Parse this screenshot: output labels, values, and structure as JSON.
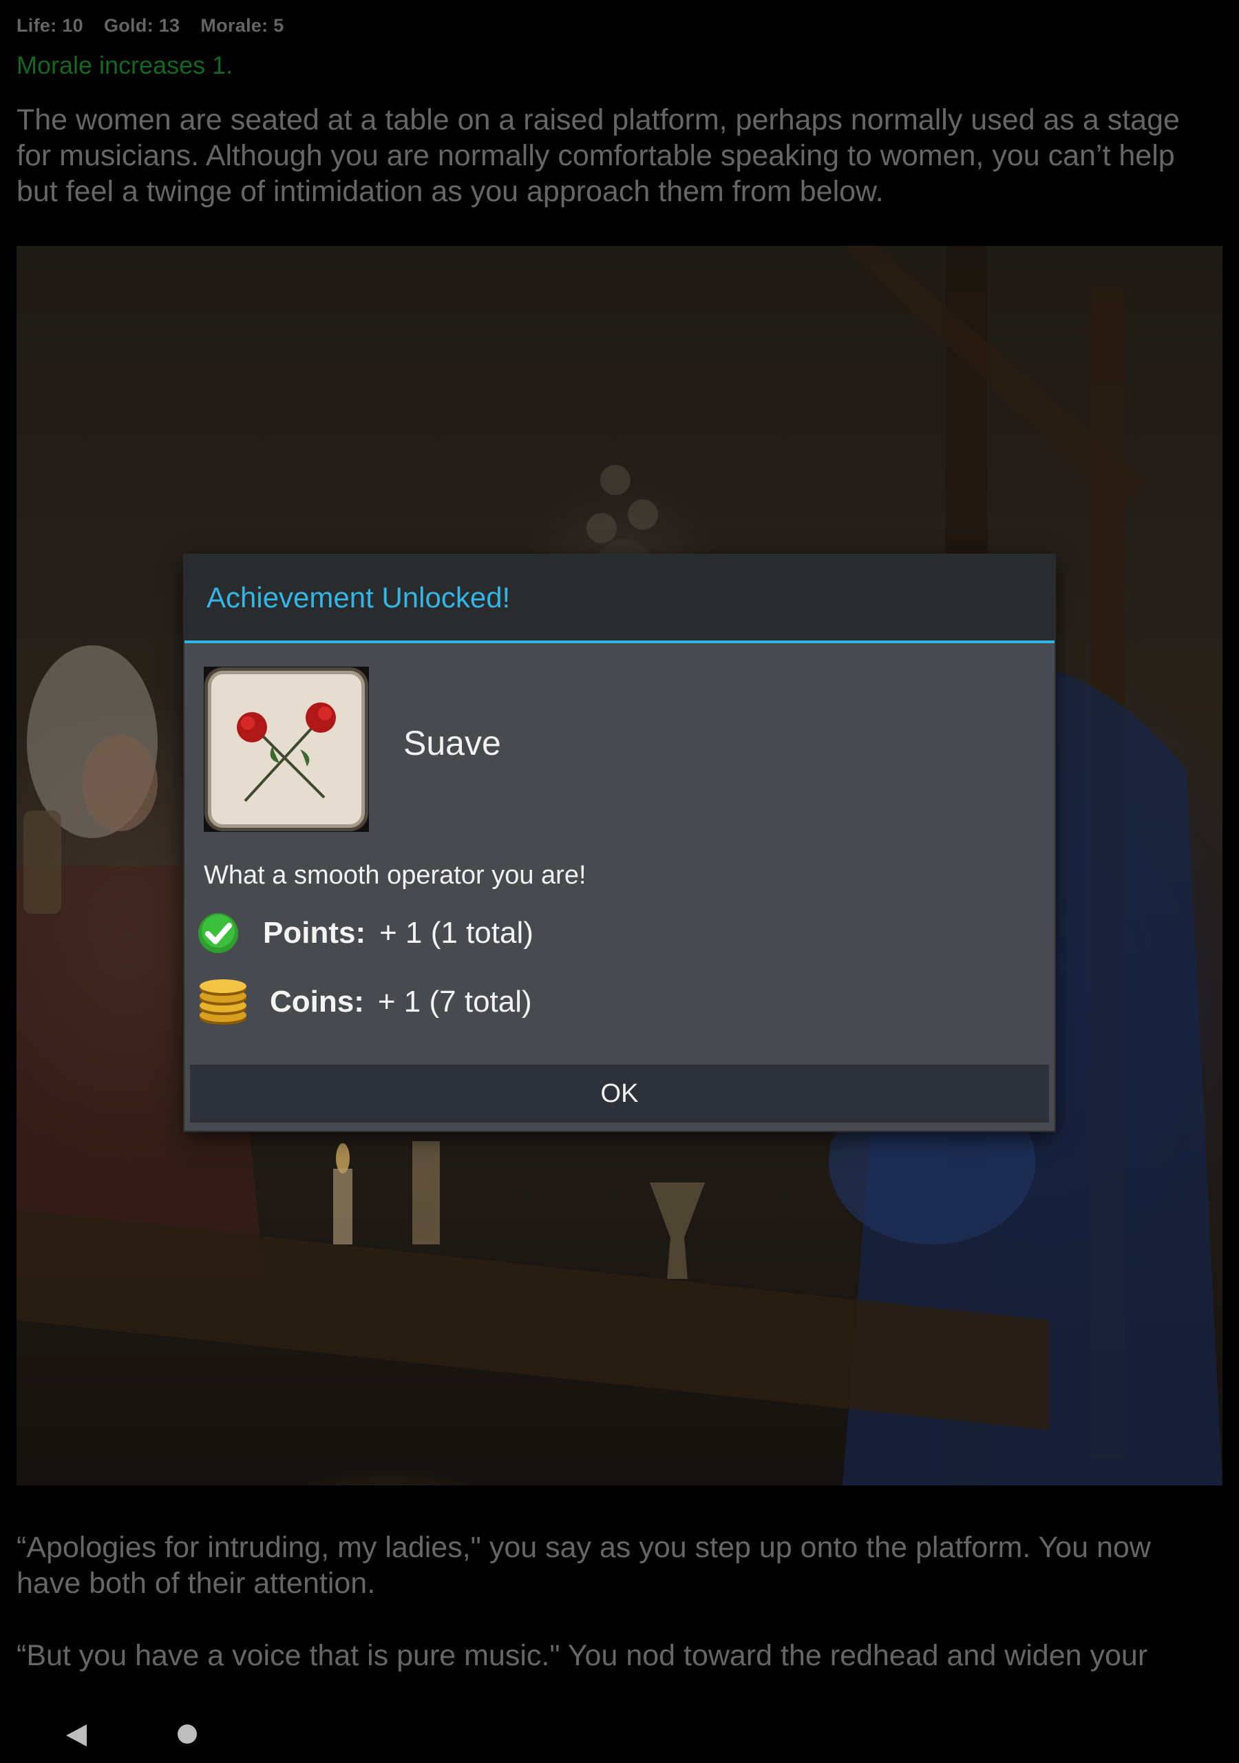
{
  "stats": {
    "life": "Life: 10",
    "gold": "Gold: 13",
    "morale": "Morale: 5"
  },
  "status_message": "Morale increases 1.",
  "story": {
    "paragraph_1": "The women are seated at a table on a raised platform, perhaps normally used as a stage for musicians. Although you are normally comfortable speaking to women, you can’t help but feel a twinge of intimidation as you approach them from below.",
    "paragraph_2": "“Apologies for intruding, my ladies,\" you say as you step up onto the platform. You now have both of their attention.",
    "paragraph_3": "“But you have a voice that is pure music.\" You nod toward the redhead and widen your"
  },
  "dialog": {
    "title": "Achievement Unlocked!",
    "achievement_name": "Suave",
    "achievement_icon": "crossed-roses-icon",
    "description": "What a smooth operator you are!",
    "points": {
      "label": "Points:",
      "value": "+ 1 (1 total)",
      "icon": "checkmark-icon"
    },
    "coins": {
      "label": "Coins:",
      "value": "+ 1 (7 total)",
      "icon": "coin-stack-icon"
    },
    "ok_label": "OK"
  },
  "colors": {
    "accent": "#33b5e5",
    "status_green": "#1d8f2a",
    "dialog_bg": "#474a4f"
  },
  "navbar": {
    "back_icon": "back-triangle-icon",
    "home_icon": "home-circle-icon"
  }
}
